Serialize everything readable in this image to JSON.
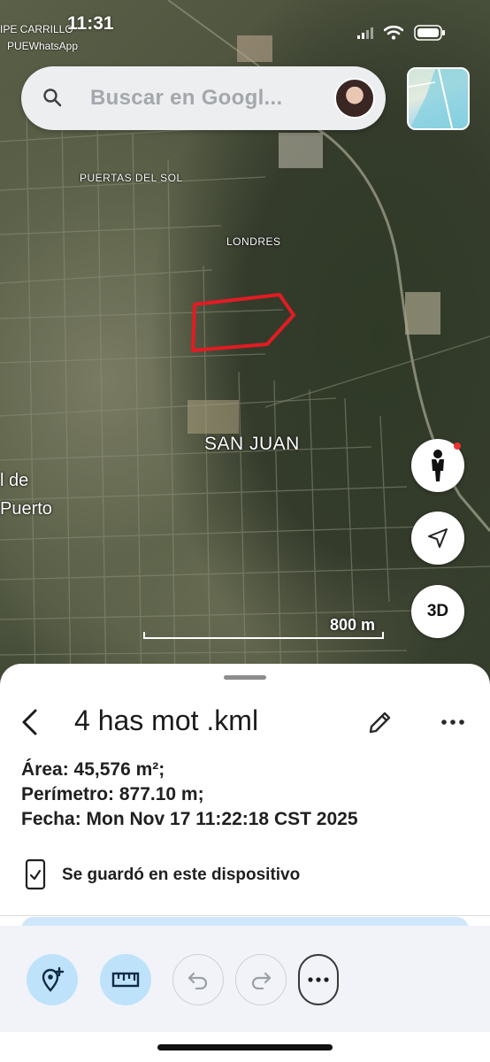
{
  "status_bar": {
    "time": "11:31",
    "sub_line_1": "IPE CARRILLO",
    "sub_line_2": "PUEWhatsApp"
  },
  "search": {
    "placeholder": "Buscar en Googl..."
  },
  "map": {
    "labels": {
      "puertas_del_sol": "PUERTAS DEL SOL",
      "londres": "LONDRES",
      "san_juan": "SAN JUAN",
      "edge_top": "l de",
      "edge_bottom": "Puerto"
    },
    "scale": "800 m",
    "three_d_label": "3D",
    "polygon_color": "#e31b23"
  },
  "sheet": {
    "title": "4 has mot .kml",
    "area": "Área: 45,576 m²;",
    "perimeter": "Perímetro: 877.10 m;",
    "date": "Fecha: Mon Nov 17 11:22:18 CST 2025",
    "saved_text": "Se guardó en este dispositivo"
  },
  "toolbar": {
    "icons": [
      "add-place-icon",
      "ruler-icon",
      "undo-icon",
      "redo-icon",
      "more-horizontal-icon"
    ]
  },
  "colors": {
    "accent_light": "#bfe2fb",
    "search_bg": "#eceef0"
  }
}
